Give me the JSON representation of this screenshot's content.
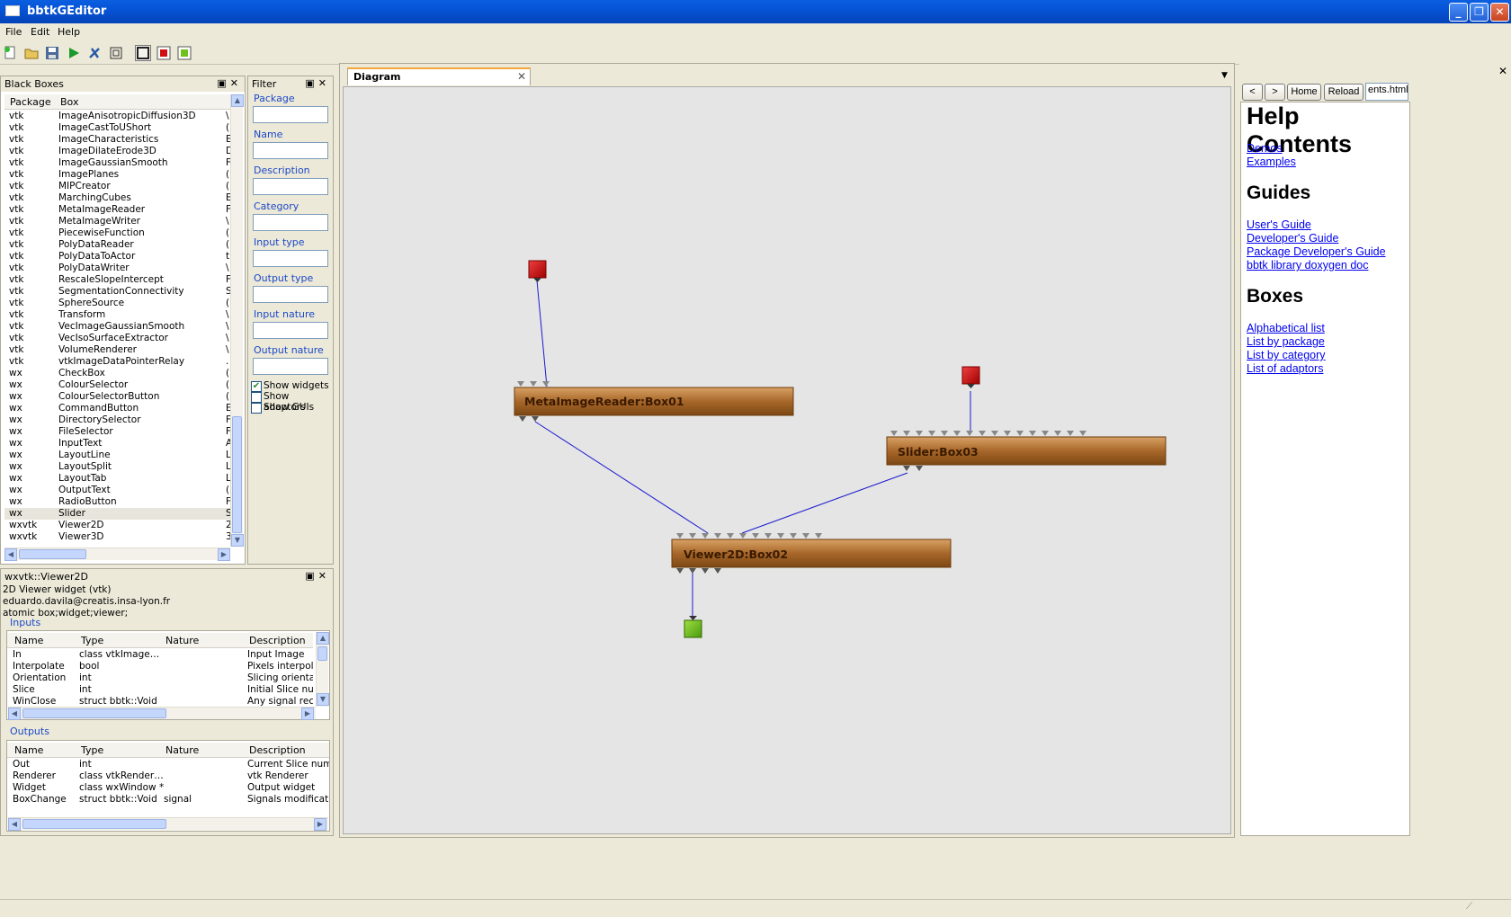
{
  "window": {
    "title": "bbtkGEditor"
  },
  "menu": [
    "File",
    "Edit",
    "Help"
  ],
  "blackboxes": {
    "title": "Black Boxes",
    "col_package": "Package",
    "col_box": "Box",
    "rows": [
      [
        "vtk",
        "ImageAnisotropicDiffusion3D",
        "\\"
      ],
      [
        "vtk",
        "ImageCastToUShort",
        "("
      ],
      [
        "vtk",
        "ImageCharacteristics",
        "E"
      ],
      [
        "vtk",
        "ImageDilateErode3D",
        "D"
      ],
      [
        "vtk",
        "ImageGaussianSmooth",
        "F"
      ],
      [
        "vtk",
        "ImagePlanes",
        "("
      ],
      [
        "vtk",
        "MIPCreator",
        "("
      ],
      [
        "vtk",
        "MarchingCubes",
        "E"
      ],
      [
        "vtk",
        "MetaImageReader",
        "F"
      ],
      [
        "vtk",
        "MetaImageWriter",
        "\\"
      ],
      [
        "vtk",
        "PiecewiseFunction",
        "("
      ],
      [
        "vtk",
        "PolyDataReader",
        "("
      ],
      [
        "vtk",
        "PolyDataToActor",
        "t"
      ],
      [
        "vtk",
        "PolyDataWriter",
        "\\"
      ],
      [
        "vtk",
        "RescaleSlopeIntercept",
        "F"
      ],
      [
        "vtk",
        "SegmentationConnectivity",
        "S"
      ],
      [
        "vtk",
        "SphereSource",
        "("
      ],
      [
        "vtk",
        "Transform",
        "\\"
      ],
      [
        "vtk",
        "VecImageGaussianSmooth",
        "\\"
      ],
      [
        "vtk",
        "VecIsoSurfaceExtractor",
        "\\"
      ],
      [
        "vtk",
        "VolumeRenderer",
        "\\"
      ],
      [
        "vtk",
        "vtkImageDataPointerRelay",
        "."
      ],
      [
        "wx",
        "CheckBox",
        "("
      ],
      [
        "wx",
        "ColourSelector",
        "("
      ],
      [
        "wx",
        "ColourSelectorButton",
        "("
      ],
      [
        "wx",
        "CommandButton",
        "E"
      ],
      [
        "wx",
        "DirectorySelector",
        "F"
      ],
      [
        "wx",
        "FileSelector",
        "F"
      ],
      [
        "wx",
        "InputText",
        "A"
      ],
      [
        "wx",
        "LayoutLine",
        "L"
      ],
      [
        "wx",
        "LayoutSplit",
        "L"
      ],
      [
        "wx",
        "LayoutTab",
        "L"
      ],
      [
        "wx",
        "OutputText",
        "("
      ],
      [
        "wx",
        "RadioButton",
        "F"
      ],
      [
        "wx",
        "Slider",
        "S"
      ],
      [
        "wxvtk",
        "Viewer2D",
        "2"
      ],
      [
        "wxvtk",
        "Viewer3D",
        "3"
      ]
    ]
  },
  "filter": {
    "title": "Filter",
    "fields": [
      "Package",
      "Name",
      "Description",
      "Category",
      "Input type",
      "Output type",
      "Input nature",
      "Output nature"
    ],
    "checks": [
      {
        "label": "Show widgets",
        "checked": true
      },
      {
        "label": "Show adaptors",
        "checked": false
      },
      {
        "label": "Show GUIs",
        "checked": false
      }
    ]
  },
  "boxinfo": {
    "title": "wxvtk::Viewer2D",
    "line1": "2D Viewer widget (vtk)",
    "line2": "eduardo.davila@creatis.insa-lyon.fr",
    "line3": "atomic box;widget;viewer;",
    "inputs_label": "Inputs",
    "outputs_label": "Outputs",
    "col_name": "Name",
    "col_type": "Type",
    "col_nature": "Nature",
    "col_desc": "Description",
    "inputs": [
      [
        "In",
        "class vtkImage…",
        "",
        "Input Image"
      ],
      [
        "Interpolate",
        "bool",
        "",
        "Pixels interpolati"
      ],
      [
        "Orientation",
        "int",
        "",
        "Slicing orientatio"
      ],
      [
        "Slice",
        "int",
        "",
        "Initial Slice numb"
      ],
      [
        "WinClose",
        "struct bbtk::Void",
        "",
        "Any signal receiv"
      ]
    ],
    "outputs": [
      [
        "Out",
        "int",
        "",
        "Current Slice numbe"
      ],
      [
        "Renderer",
        "class vtkRender…",
        "",
        "vtk Renderer"
      ],
      [
        "Widget",
        "class wxWindow *",
        "",
        "Output widget"
      ],
      [
        "BoxChange",
        "struct bbtk::Void",
        "signal",
        "Signals modification"
      ]
    ]
  },
  "diagram": {
    "tab": "Diagram",
    "boxes": [
      "MetaImageReader:Box01",
      "Slider:Box03",
      "Viewer2D:Box02"
    ]
  },
  "help": {
    "back": "<",
    "forward": ">",
    "home": "Home",
    "reload": "Reload",
    "url": "ents.html",
    "title": "Help Contents",
    "links_top": [
      "Demos",
      "Examples"
    ],
    "guides_title": "Guides",
    "guides": [
      "User's Guide",
      "Developer's Guide",
      "Package Developer's Guide",
      "bbtk library doxygen doc"
    ],
    "boxes_title": "Boxes",
    "boxes": [
      "Alphabetical list",
      "List by package",
      "List by category",
      "List of adaptors"
    ]
  },
  "colors": {
    "accent": "#0453d6",
    "box": "#a8672a",
    "link": "#0000ee",
    "wire": "#1a1ad0"
  }
}
